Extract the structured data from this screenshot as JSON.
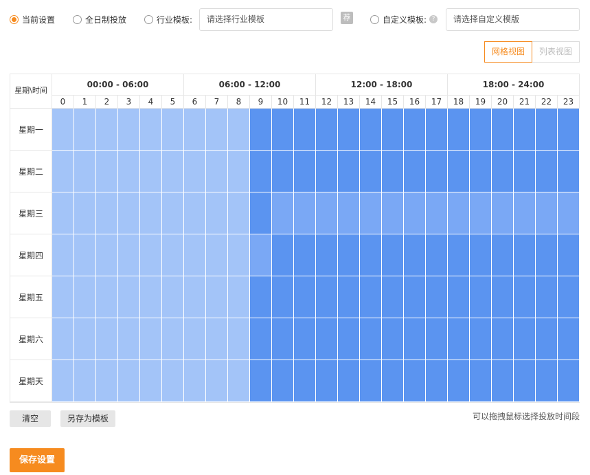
{
  "options": {
    "current": "当前设置",
    "all_day": "全日制投放",
    "industry": "行业模板:",
    "industry_placeholder": "请选择行业模板",
    "recommend_icon": "荐",
    "custom": "自定义模板:",
    "help_icon": "?",
    "custom_placeholder": "请选择自定义模版",
    "selected": "current"
  },
  "view": {
    "grid": "网格视图",
    "list": "列表视图",
    "active": "grid"
  },
  "schedule": {
    "corner": "星期\\时间",
    "ranges": [
      "00:00 - 06:00",
      "06:00 - 12:00",
      "12:00 - 18:00",
      "18:00 - 24:00"
    ],
    "hours": [
      "0",
      "1",
      "2",
      "3",
      "4",
      "5",
      "6",
      "7",
      "8",
      "9",
      "10",
      "11",
      "12",
      "13",
      "14",
      "15",
      "16",
      "17",
      "18",
      "19",
      "20",
      "21",
      "22",
      "23"
    ],
    "days": [
      "星期一",
      "星期二",
      "星期三",
      "星期四",
      "星期五",
      "星期六",
      "星期天"
    ],
    "colors": {
      "light": "#a3c4f8",
      "mid": "#7aa8f5",
      "dark": "#5b94f0"
    },
    "levels": [
      "LLLLLLLLLDDDDDDDDDDDDDDD",
      "LLLLLLLLLDDDDDDDDDDDDDDD",
      "LLLLLLLLLDMMMMMMMMMMMMMM",
      "LLLLLLLLLMDDDDDDDDDDDDDD",
      "LLLLLLLLLDDDDDDDDDDDDDDD",
      "LLLLLLLLLDDDDDDDDDDDDDDD",
      "LLLLLLLLLDDDDDDDDDDDDDDD"
    ]
  },
  "actions": {
    "clear": "清空",
    "save_template": "另存为模板",
    "hint": "可以拖拽鼠标选择投放时间段",
    "save": "保存设置"
  }
}
